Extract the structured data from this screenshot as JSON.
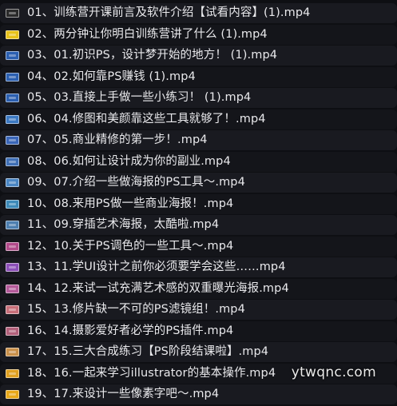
{
  "files": [
    {
      "name": "01、训练营开课前言及软件介绍【试看内容】(1).mp4",
      "thumb_color": "#2a2a2a"
    },
    {
      "name": "02、两分钟让你明白训练营讲了什么 (1).mp4",
      "thumb_color": "#e8c21a"
    },
    {
      "name": "03、01.初识PS，设计梦开始的地方！ (1).mp4",
      "thumb_color": "#2b5fb0"
    },
    {
      "name": "04、02.如何靠PS赚钱 (1).mp4",
      "thumb_color": "#2b5fb0"
    },
    {
      "name": "05、03.直接上手做一些小练习！  (1).mp4",
      "thumb_color": "#2b5fb0"
    },
    {
      "name": "06、04.修图和美颜靠这些工具就够了！.mp4",
      "thumb_color": "#3c79c2"
    },
    {
      "name": "07、05.商业精修的第一步！.mp4",
      "thumb_color": "#3a66b8"
    },
    {
      "name": "08、06.如何让设计成为你的副业.mp4",
      "thumb_color": "#3f6fb5"
    },
    {
      "name": "09、07.介绍一些做海报的PS工具～.mp4",
      "thumb_color": "#4a86c4"
    },
    {
      "name": "10、08.来用PS做一些商业海报！.mp4",
      "thumb_color": "#3d8ab8"
    },
    {
      "name": "11、09.穿插艺术海报，太酷啦.mp4",
      "thumb_color": "#4d7fb0"
    },
    {
      "name": "12、10.关于PS调色的一些工具～.mp4",
      "thumb_color": "#b24a8a"
    },
    {
      "name": "13、11.学UI设计之前你必须要学会这些……mp4",
      "thumb_color": "#8c4fb8"
    },
    {
      "name": "14、12.来试一试充满艺术感的双重曝光海报.mp4",
      "thumb_color": "#b45a9a"
    },
    {
      "name": "15、13.修片缺一不可的PS滤镜组！.mp4",
      "thumb_color": "#c86f7a"
    },
    {
      "name": "16、14.摄影爱好者必学的PS插件.mp4",
      "thumb_color": "#b2607a"
    },
    {
      "name": "17、15.三大合成练习【PS阶段结课啦】.mp4",
      "thumb_color": "#c9904a"
    },
    {
      "name": "18、16.一起来学习illustrator的基本操作.mp4",
      "thumb_color": "#e0a020"
    },
    {
      "name": "19、17.来设计一些像素字吧～.mp4",
      "thumb_color": "#e8a818"
    }
  ],
  "watermark": "ytwqnc.com"
}
